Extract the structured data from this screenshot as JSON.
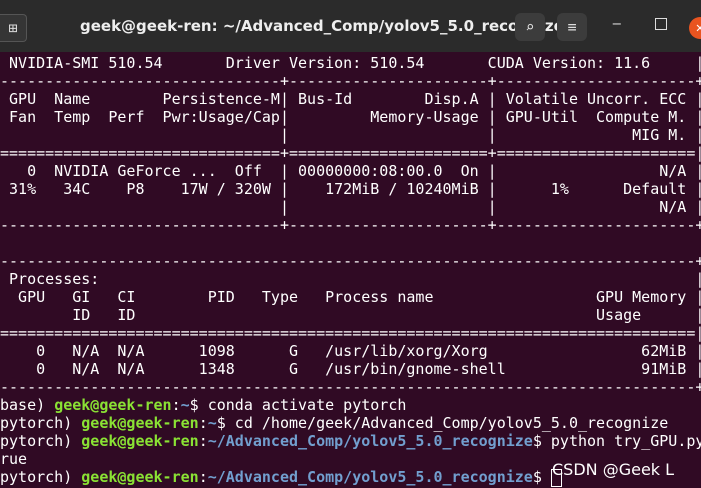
{
  "window": {
    "title": "geek@geek-ren: ~/Advanced_Comp/yolov5_5.0_recognize",
    "new_tab_icon": "⊞",
    "search_icon": "⌕",
    "menu_icon": "≡",
    "minimize_icon": "‒",
    "close_icon": "✕",
    "accent": "#e95420",
    "background": "#300a24"
  },
  "nvidia_smi": {
    "lines": [
      " NVIDIA-SMI 510.54       Driver Version: 510.54       CUDA Version: 11.6     |",
      "-------------------------------+----------------------+----------------------+",
      " GPU  Name        Persistence-M| Bus-Id        Disp.A | Volatile Uncorr. ECC |",
      " Fan  Temp  Perf  Pwr:Usage/Cap|         Memory-Usage | GPU-Util  Compute M. |",
      "                               |                      |               MIG M. |",
      "===============================+======================+======================|",
      "   0  NVIDIA GeForce ...  Off  | 00000000:08:00.0  On |                  N/A |",
      " 31%   34C    P8    17W / 320W |    172MiB / 10240MiB |      1%      Default |",
      "                               |                      |                  N/A |",
      "-------------------------------+----------------------+----------------------+",
      "",
      "-----------------------------------------------------------------------------+",
      " Processes:                                                                  |",
      "  GPU   GI   CI        PID   Type   Process name                  GPU Memory |",
      "        ID   ID                                                   Usage      |",
      "=============================================================================|",
      "    0   N/A  N/A      1098      G   /usr/lib/xorg/Xorg                 62MiB |",
      "    0   N/A  N/A      1348      G   /usr/bin/gnome-shell               91MiB |",
      "-----------------------------------------------------------------------------+"
    ]
  },
  "shell": {
    "user_host": "geek@geek-ren",
    "lines": [
      {
        "env": "base) ",
        "path": "~",
        "command": "$ conda activate pytorch"
      },
      {
        "env": "pytorch) ",
        "path": "~",
        "command": "$ cd /home/geek/Advanced_Comp/yolov5_5.0_recognize"
      },
      {
        "env": "pytorch) ",
        "path": "~/Advanced_Comp/yolov5_5.0_recognize",
        "command": "$ python try_GPU.py"
      },
      {
        "output": "rue"
      },
      {
        "env": "pytorch) ",
        "path": "~/Advanced_Comp/yolov5_5.0_recognize",
        "command": "$ "
      }
    ]
  },
  "watermark": "CSDN @Geek L"
}
